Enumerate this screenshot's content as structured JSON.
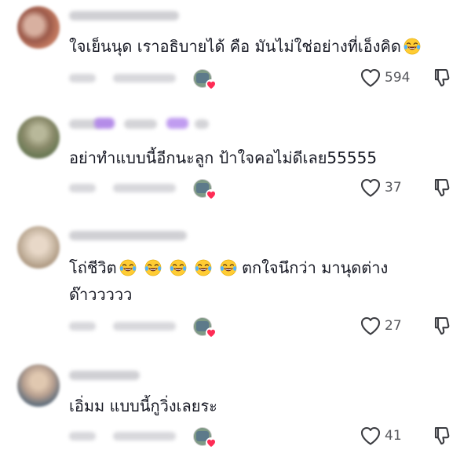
{
  "comments": [
    {
      "text_lines": [
        "ใจเย็นนุด เราอธิบายได้ คือ มันไม่ใช่อย่างที่เอ็งคิด"
      ],
      "emoji_count": 1,
      "likes": "594",
      "avatar_color": "#9c5a4a"
    },
    {
      "text_lines": [
        "อย่าทำแบบนี้อีกนะลูก ป้าใจคอไม่ดีเลย55555"
      ],
      "emoji_count": 0,
      "likes": "37",
      "avatar_color": "#8a8a6a"
    },
    {
      "text_lines": [
        "โถ่ชีวิต",
        " ตกใจนึกว่า มานุดต่าง",
        "ด๊าววววว"
      ],
      "emoji_count": 5,
      "likes": "27",
      "avatar_color": "#c9b8a4"
    },
    {
      "text_lines": [
        "เอิ่มม แบบนี้กูวิ่งเลยระ"
      ],
      "emoji_count": 0,
      "likes": "41",
      "avatar_color": "#b8a090"
    }
  ],
  "icons": {
    "like": "heart-outline-icon",
    "dislike": "thumbs-down-icon",
    "emoji": "face-with-tears-of-joy-icon",
    "creator_liked": "red-heart-icon"
  },
  "colors": {
    "text": "#161823",
    "muted": "#57585d",
    "heart_red": "#fe2c55",
    "emoji_yellow": "#ffcc33"
  }
}
